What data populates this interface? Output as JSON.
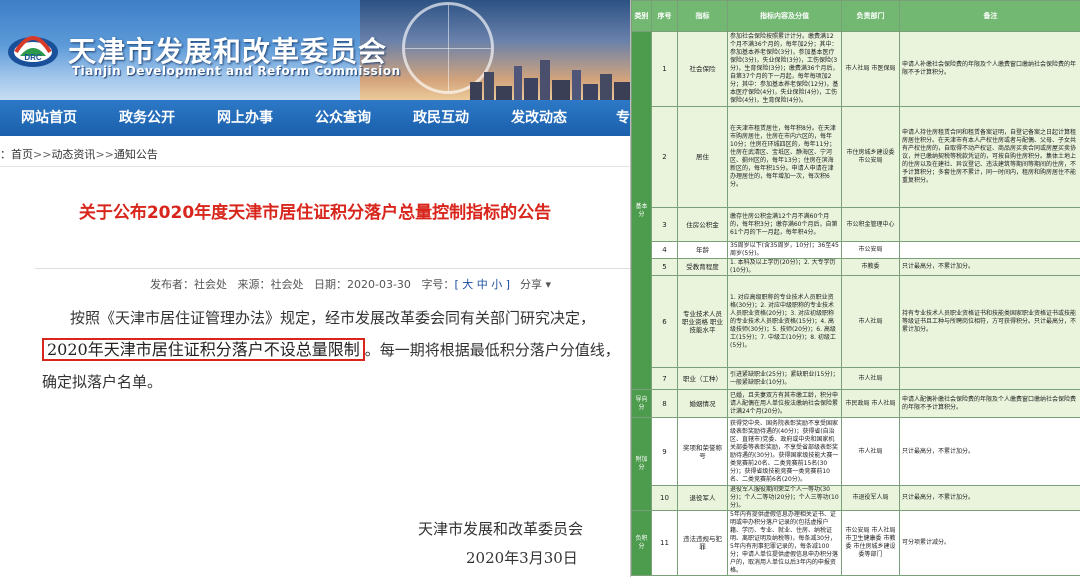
{
  "site": {
    "title": "天津市发展和改革委员会",
    "subtitle": "Tianjin Development and Reform Commission"
  },
  "nav": [
    "网站首页",
    "政务公开",
    "网上办事",
    "公众查询",
    "政民互动",
    "发改动态",
    "专题专"
  ],
  "breadcrumb": {
    "lead": "：",
    "items": [
      "首页",
      "动态资讯",
      "通知公告"
    ],
    "sep": ">>"
  },
  "notice": {
    "title": "关于公布2020年度天津市居住证积分落户总量控制指标的公告",
    "meta": {
      "publisher_label": "发布者：社会处",
      "source_label": "来源：社会处",
      "date_label": "日期：2020-03-30",
      "size_label": "字号：",
      "size_value": "[ 大 中 小 ]",
      "share": "分享"
    },
    "body_part1": "按照《天津市居住证管理办法》规定，经市发展改革委会同有关部门研究决定，",
    "highlight": "2020年天津市居住证积分落户不设总量限制",
    "body_part2": "。每一期将根据最低积分落户分值线，确定拟落户名单。",
    "sign_org": "天津市发展和改革委员会",
    "sign_date": "2020年3月30日"
  },
  "table": {
    "headers": [
      "类别",
      "序号",
      "指标",
      "指标内容及分值",
      "负责部门",
      "备注"
    ],
    "categories": [
      {
        "label": "基本分",
        "rows": 7
      },
      {
        "label": "导向分",
        "rows": 1
      },
      {
        "label": "附加分",
        "rows": 2
      },
      {
        "label": "负积分",
        "rows": 1
      }
    ],
    "rows": [
      {
        "no": "1",
        "ind": "社会保险",
        "content": "参加社会保险按照累计计分。缴费满12个月不满36个月的，每年加2分；其中：参加基本养老保险(3分)，参加基本医疗保险(3分)，失业保险(3分)，工伤保险(3分)，生育保险(3分)；缴费满36个月后，自第37个月的下一月起，每年每项加2分；其中：参加基本养老保险(12分)，基本医疗保险(4分)，失业保险(4分)，工伤保险(4分)，生育保险(4分)。",
        "dept": "市人社局 市医保局",
        "note": "申请人补缴社会保险费的年限及个人缴费窗口缴纳社会保险费的年限不予计算积分。"
      },
      {
        "no": "2",
        "ind": "居住",
        "content": "在天津市租赁居住，每年积8分。在天津市购房居住，住房在市内六区的，每年10分；住房在环城四区的，每年11分；住房在武清区、宝坻区、静海区、宁河区、蓟州区的，每年13分；住房在滨海新区的，每年积15分。申请人申请在津办理居住的，每年增加一次，每次积6分。",
        "dept": "市住房城乡建设委 市公安局",
        "note": "申请人持住房租赁合同和租赁备案证明，自登记备案之日起计算租房居住积分。在天津市有本人产权住房或者与配偶、父母、子女共有产权住房的，自取得不动产权证、商品房买卖合同或房屋买卖协议，并已缴纳契税等税款凭证的，可按自购住房积分。集体土地上的住房以及在建社、异议登记、违法建筑等期间等期间的住房，不予计算积分；多套住房不累计，同一时间内，租房和购房居住不能重复积分。"
      },
      {
        "no": "3",
        "ind": "住房公积金",
        "content": "缴存住房公积金满12个月不满60个月的，每年积3分；缴存满60个月后，自第61个月的下一月起，每年积4分。",
        "dept": "市公积金管理中心",
        "note": ""
      },
      {
        "no": "4",
        "ind": "年龄",
        "content": "35周岁以下(含35周岁，10分)；36至45周岁(5分)。",
        "dept": "市公安局",
        "note": ""
      },
      {
        "no": "5",
        "ind": "受教育程度",
        "content": "1. 本科及以上学历(20分)；2. 大专学历(10分)。",
        "dept": "市教委",
        "note": "只计最高分，不累计加分。"
      },
      {
        "no": "6",
        "ind": "专业技术人员职业资格 职业技能水平",
        "content": "1. 对应高级职称的专业技术人员职业资格(30分)；2. 对应中级职称的专业技术人员职业资格(20分)；3. 对应初级职称的专业技术人员职业资格(15分)；4. 高级技师(30分)；5. 技师(20分)；6. 高级工(15分)；7. 中级工(10分)；8. 初级工(5分)。",
        "dept": "市人社局",
        "note": "持有专业技术人员职业资格证书和技能类国家职业资格证书或技能等级证书且工种与所聘岗位相符，方可获得积分。只计最高分，不累计加分。"
      },
      {
        "no": "7",
        "ind": "职业（工种）",
        "content": "引进紧缺职业(25分)；紧缺职业(15分)；一般紧缺职业(10分)。",
        "dept": "市人社局",
        "note": ""
      },
      {
        "no": "8",
        "ind": "婚姻情况",
        "content": "已婚，且夫妻双方有其市缴工龄，积分申请人配偶在用人单位按法缴纳社会保险累计满24个月(20分)。",
        "dept": "市民政局 市人社局",
        "note": "申请人配偶补缴社会保险费的年限及个人缴费窗口缴纳社会保险费的年限不予计算积分。"
      },
      {
        "no": "9",
        "ind": "奖项和荣誉称号",
        "content": "获得党中央、国务院表彰奖励不享受国家级表彰奖励待遇的(40分)；获得省(自治区、直辖市)党委、政府或中央和国家机关部委等表彰奖励，不享受省部级表彰奖励待遇的(30分)。获得国家级技能大赛一类竞赛前20名、二类竞赛前15名(30分)；获得省级技能竞赛一类竞赛前10名、二类竞赛前6名(20分)。",
        "dept": "市人社局",
        "note": "只计最高分，不累计加分。"
      },
      {
        "no": "10",
        "ind": "退役军人",
        "content": "退役军人服役期间荣立个人一等功(30分)；个人二等功(20分)；个人三等功(10分)。",
        "dept": "市退役军人局",
        "note": "只计最高分，不累计加分。"
      },
      {
        "no": "11",
        "ind": "违法违规与犯罪",
        "content": "5年内有提供虚假信息办理相关证书、证明或申办积分落户记录的(包括虚报户籍、学历、专业、就业、住房、纳税证明、离职证明及纳税等)，每条减30分，5年内有刑事犯罪记录的，每条减100分；申请人单位提供虚假信息申办积分落户的，取消用人单位以后3年内的申报资格。",
        "dept": "市公安局 市人社局 市卫生健康委 市教委 市住房城乡建设委等部门",
        "note": "可分项累计减分。"
      }
    ]
  }
}
